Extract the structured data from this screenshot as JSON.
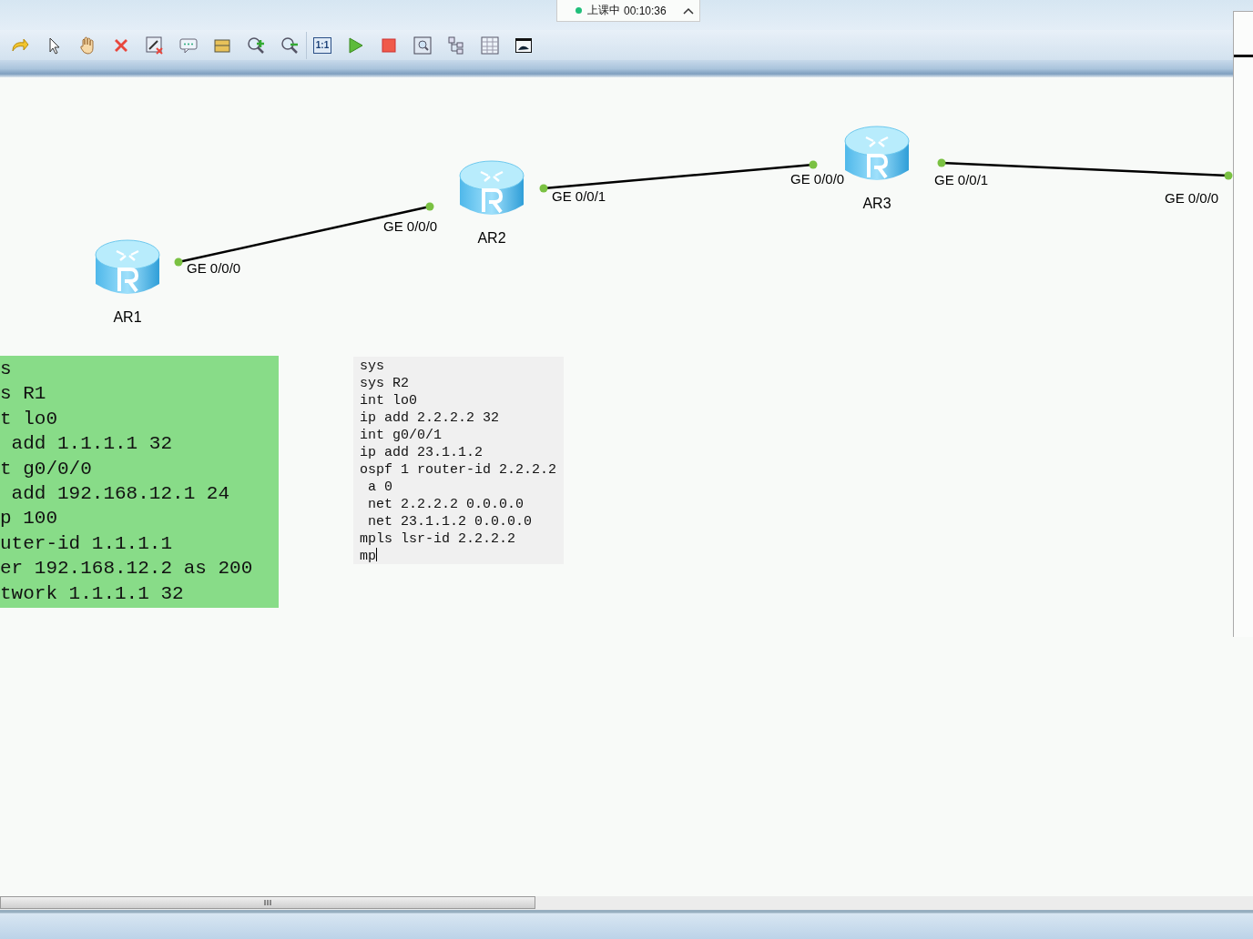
{
  "session_badge": {
    "label": "上课中",
    "time": "00:10:36"
  },
  "toolbar": [
    {
      "kind": "redo"
    },
    {
      "kind": "pointer"
    },
    {
      "kind": "hand"
    },
    {
      "kind": "delete"
    },
    {
      "kind": "remove-link"
    },
    {
      "kind": "note"
    },
    {
      "kind": "rectangle"
    },
    {
      "kind": "zoom-in"
    },
    {
      "kind": "zoom-out",
      "separator_after": true
    },
    {
      "kind": "fit",
      "label": "1:1"
    },
    {
      "kind": "start"
    },
    {
      "kind": "stop"
    },
    {
      "kind": "capture"
    },
    {
      "kind": "topology"
    },
    {
      "kind": "grid"
    },
    {
      "kind": "console"
    }
  ],
  "routers": [
    {
      "name": "AR1"
    },
    {
      "name": "AR2"
    },
    {
      "name": "AR3"
    }
  ],
  "links": [
    {
      "a_port": "GE 0/0/0",
      "b_port": "GE 0/0/0"
    },
    {
      "a_port": "GE 0/0/1",
      "b_port": "GE 0/0/0"
    },
    {
      "a_port": "GE 0/0/1",
      "b_port": "GE 0/0/0"
    }
  ],
  "notes": [
    {
      "kind": "green",
      "lines": [
        "s",
        "s R1",
        "t lo0",
        " add 1.1.1.1 32",
        "t g0/0/0",
        " add 192.168.12.1 24",
        "p 100",
        "uter-id 1.1.1.1",
        "er 192.168.12.2 as 200",
        "twork 1.1.1.1 32"
      ],
      "cursor": false
    },
    {
      "kind": "gray",
      "lines": [
        "sys",
        "sys R2",
        "int lo0",
        "ip add 2.2.2.2 32",
        "int g0/0/1",
        "ip add 23.1.1.2",
        "ospf 1 router-id 2.2.2.2",
        " a 0",
        " net 2.2.2.2 0.0.0.0",
        " net 23.1.1.2 0.0.0.0",
        "mpls lsr-id 2.2.2.2",
        "mp"
      ],
      "cursor": true
    }
  ]
}
